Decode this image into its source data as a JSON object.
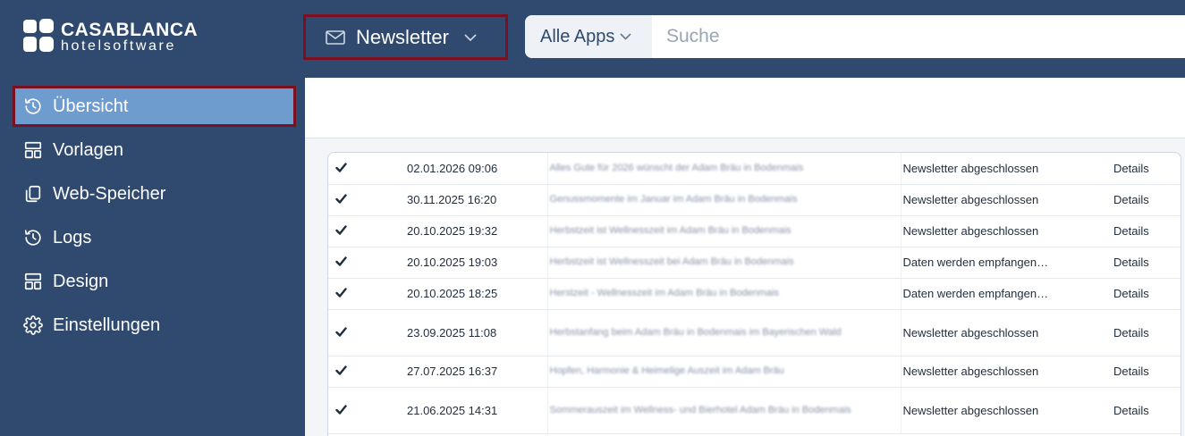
{
  "logo": {
    "line1": "CASABLANCA",
    "line2": "hotelsoftware"
  },
  "sidebar": {
    "items": [
      {
        "label": "Übersicht",
        "icon": "history-icon"
      },
      {
        "label": "Vorlagen",
        "icon": "layout-icon"
      },
      {
        "label": "Web-Speicher",
        "icon": "files-icon"
      },
      {
        "label": "Logs",
        "icon": "history-icon"
      },
      {
        "label": "Design",
        "icon": "layout-icon"
      },
      {
        "label": "Einstellungen",
        "icon": "gear-icon"
      }
    ],
    "active_index": 0
  },
  "header": {
    "app_name": "Newsletter",
    "apps_filter": "Alle Apps",
    "search_placeholder": "Suche"
  },
  "table": {
    "rows": [
      {
        "date": "02.01.2026 09:06",
        "subject": "Alles Gute für 2026 wünscht der Adam Bräu in Bodenmais",
        "status": "Newsletter abgeschlossen",
        "action": "Details"
      },
      {
        "date": "30.11.2025 16:20",
        "subject": "Genussmomente im Januar im Adam Bräu in Bodenmais",
        "status": "Newsletter abgeschlossen",
        "action": "Details"
      },
      {
        "date": "20.10.2025 19:32",
        "subject": "Herbstzeit ist Wellnesszeit im Adam Bräu in Bodenmais",
        "status": "Newsletter abgeschlossen",
        "action": "Details"
      },
      {
        "date": "20.10.2025 19:03",
        "subject": "Herbstzeit ist Wellnesszeit bei Adam Bräu in Bodenmais",
        "status": "Daten werden empfangen…",
        "action": "Details"
      },
      {
        "date": "20.10.2025 18:25",
        "subject": "Herstzeit - Wellnesszeit im Adam Bräu in Bodenmais",
        "status": "Daten werden empfangen…",
        "action": "Details"
      },
      {
        "date": "23.09.2025 11:08",
        "subject": "Herbstanfang beim Adam Bräu in Bodenmais im Bayerischen Wald",
        "status": "Newsletter abgeschlossen",
        "action": "Details"
      },
      {
        "date": "27.07.2025 16:37",
        "subject": "Hopfen, Harmonie & Heimelige Auszeit im Adam Bräu",
        "status": "Newsletter abgeschlossen",
        "action": "Details"
      },
      {
        "date": "21.06.2025 14:31",
        "subject": "Sommerauszeit im Wellness- und Bierhotel Adam Bräu in Bodenmais",
        "status": "Newsletter abgeschlossen",
        "action": "Details"
      }
    ]
  }
}
